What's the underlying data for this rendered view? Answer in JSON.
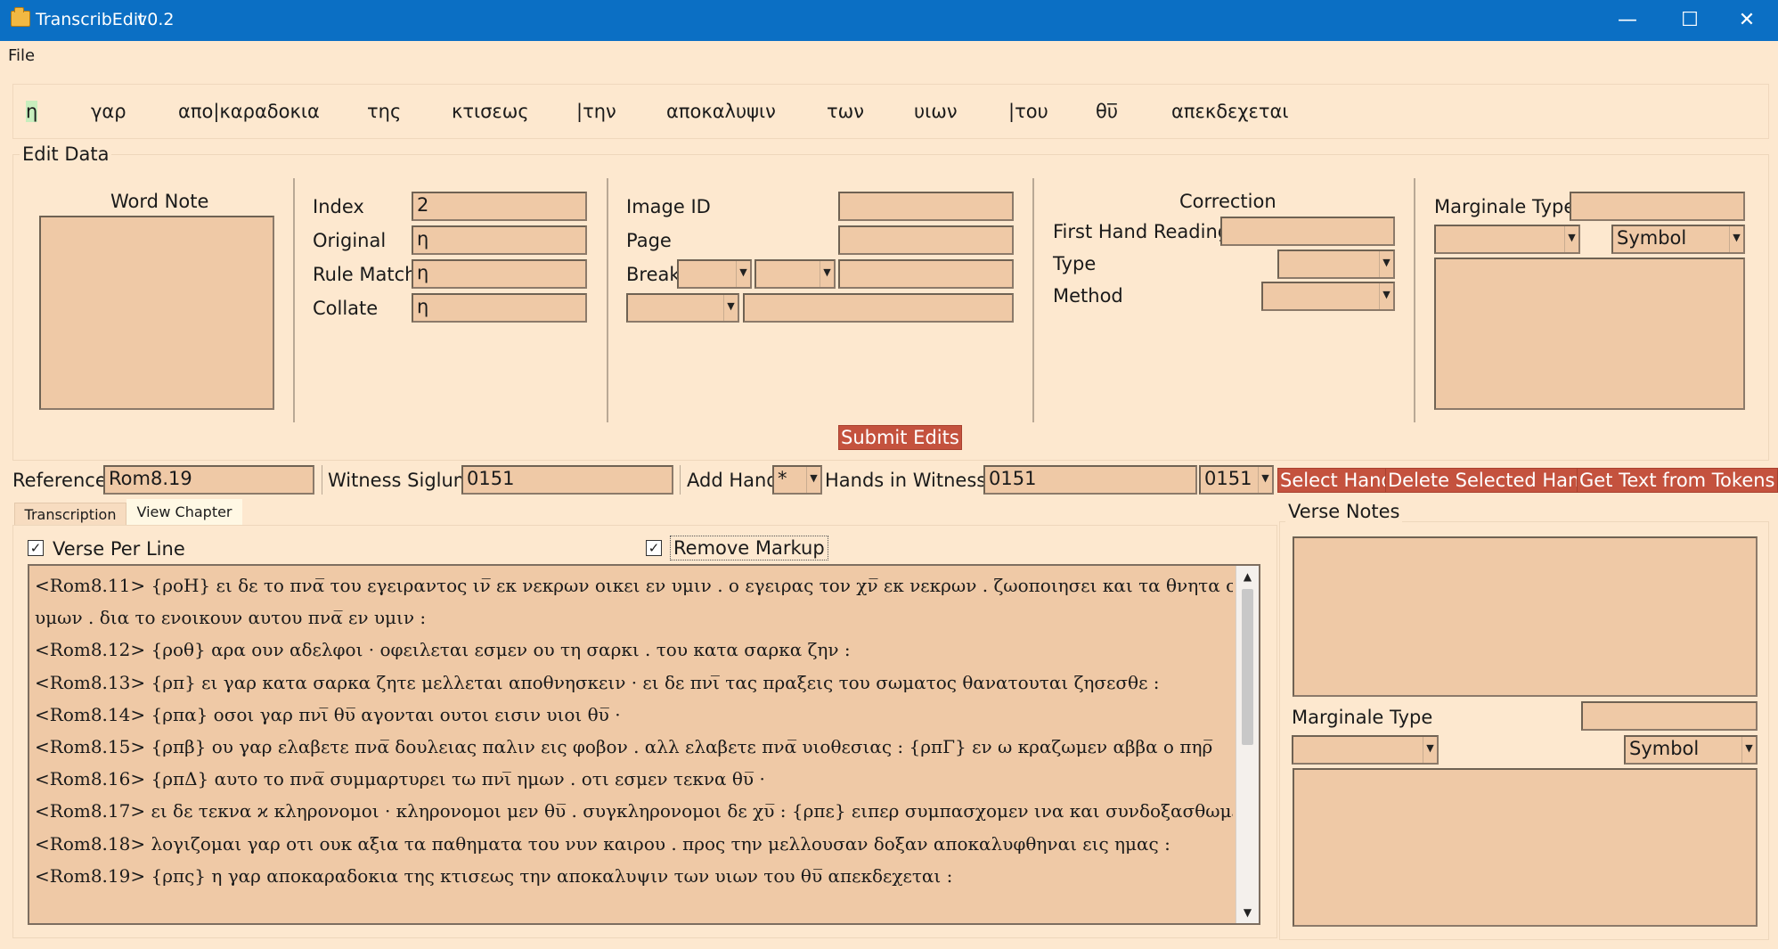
{
  "window": {
    "title": "TranscribEdit",
    "version": "v0.2",
    "minimize": "—",
    "maximize": "☐",
    "close": "✕"
  },
  "menu": {
    "file": "File"
  },
  "tokens": [
    {
      "text": "η",
      "selected": true
    },
    {
      "text": "γαρ"
    },
    {
      "text": "απο|καραδοκια"
    },
    {
      "text": "της"
    },
    {
      "text": "κτισεως"
    },
    {
      "text": "|την"
    },
    {
      "text": "αποκαλυψιν"
    },
    {
      "text": "των"
    },
    {
      "text": "υιων"
    },
    {
      "text": "|του"
    },
    {
      "text": "θυ̅"
    },
    {
      "text": "απεκδεχεται"
    }
  ],
  "edit_data": {
    "title": "Edit Data",
    "word_note_label": "Word Note",
    "index_label": "Index",
    "index_value": "2",
    "original_label": "Original",
    "original_value": "η",
    "rule_match_label": "Rule Match",
    "rule_match_value": "η",
    "collate_label": "Collate",
    "collate_value": "η",
    "image_id_label": "Image ID",
    "page_label": "Page",
    "break_label": "Break",
    "correction_title": "Correction",
    "first_hand_label": "First Hand Reading",
    "type_label": "Type",
    "method_label": "Method",
    "marginale_type_label": "Marginale Type",
    "symbol_value": "Symbol",
    "submit_label": "Submit Edits"
  },
  "witness_bar": {
    "reference_label": "Reference",
    "reference_value": "Rom8.19",
    "siglum_label": "Witness Siglum",
    "siglum_value": "0151",
    "add_hand_label": "Add Hand",
    "add_hand_value": "*",
    "hands_label": "Hands in Witness:",
    "hands_value": "0151",
    "hands_select": "0151",
    "select_hand": "Select Hand",
    "delete_hand": "Delete Selected Hand",
    "get_text": "Get Text from Tokens"
  },
  "tabs": {
    "transcription": "Transcription",
    "view_chapter": "View Chapter"
  },
  "chapter": {
    "verse_per_line": "Verse Per Line",
    "remove_markup": "Remove Markup",
    "lines": [
      "<Rom8.11> {ροΗ} ει δε το πνα̅ του εγειραντος ιν̅ εκ νεκρων οικει εν υμιν . ο εγειρας τον χν̅ εκ νεκρων . ζωοποιησει και τα θνητα σωματα",
      "υμων . δια το ενοικουν αυτου πνα̅ εν υμιν :",
      "<Rom8.12> {ροθ} αρα ουν αδελφοι · οφειλεται εσμεν ου τη σαρκι . του κατα σαρκα ζην :",
      "<Rom8.13> {ρπ} ει γαρ κατα σαρκα ζητε μελλεται αποθνησκειν · ει δε πνι̅ τας πραξεις του σωματος θανατουται ζησεσθε :",
      "<Rom8.14> {ρπα} οσοι γαρ πνι̅ θυ̅ αγονται ουτοι εισιν υιοι θυ̅ ·",
      "<Rom8.15> {ρπβ} ου γαρ ελαβετε πνα̅ δουλειας παλιν εις φοβον . αλλ ελαβετε πνα̅ υιοθεσιας : {ρπΓ} εν ω κραζωμεν αββα ο πηρ̅",
      "<Rom8.16> {ρπΔ} αυτο το πνα̅ συμμαρτυρει τω πνι̅ ημων . οτι εσμεν τεκνα θυ̅ ·",
      "<Rom8.17> ει δε τεκνα ϰ κληρονομοι · κληρονομοι μεν θυ̅ . συγκληρονομοι δε χυ̅ : {ρπε} ειπερ συμπασχομεν ινα και συνδοξασθωμεν ·",
      "<Rom8.18> λογιζομαι γαρ οτι ουκ αξια τα παθηματα του νυν καιρου . προς την μελλουσαν δοξαν αποκαλυφθηναι εις ημας :",
      "<Rom8.19> {ρπς} η γαρ αποκαραδοκια της κτισεως την αποκαλυψιν των υιων του θυ̅ απεκδεχεται :"
    ]
  },
  "verse_notes": {
    "title": "Verse Notes",
    "marginale_type_label": "Marginale Type",
    "symbol_value": "Symbol"
  },
  "colors": {
    "background": "#fde8cf",
    "field": "#efc9a6",
    "titlebar": "#0b6fc4",
    "button": "#c4523e",
    "selected_token": "#c8eebd"
  }
}
